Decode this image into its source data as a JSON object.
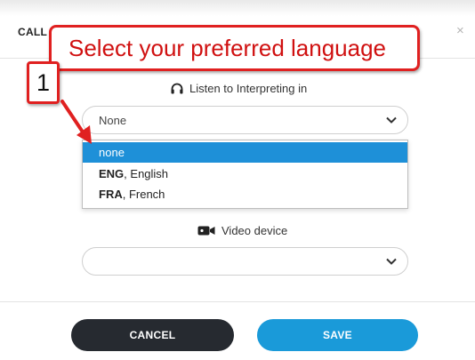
{
  "dialog": {
    "title": "CALL",
    "close_glyph": "×"
  },
  "interpreting": {
    "label": "Listen to Interpreting in",
    "icon": "headphones-icon",
    "selected_value": "None",
    "options": [
      {
        "code": "",
        "name": "none",
        "selected": true
      },
      {
        "code": "ENG",
        "name": ", English",
        "selected": false
      },
      {
        "code": "FRA",
        "name": ", French",
        "selected": false
      }
    ]
  },
  "video": {
    "label": "Video device",
    "icon": "video-camera-icon",
    "selected_value": ""
  },
  "footer": {
    "cancel_label": "CANCEL",
    "save_label": "SAVE"
  },
  "annotation": {
    "callout_text": "Select your preferred language",
    "step_number": "1"
  },
  "colors": {
    "accent": "#1a9ad9",
    "selected_option": "#1e90d8",
    "cancel_button": "#262a30",
    "annotation_red": "#e02020"
  }
}
